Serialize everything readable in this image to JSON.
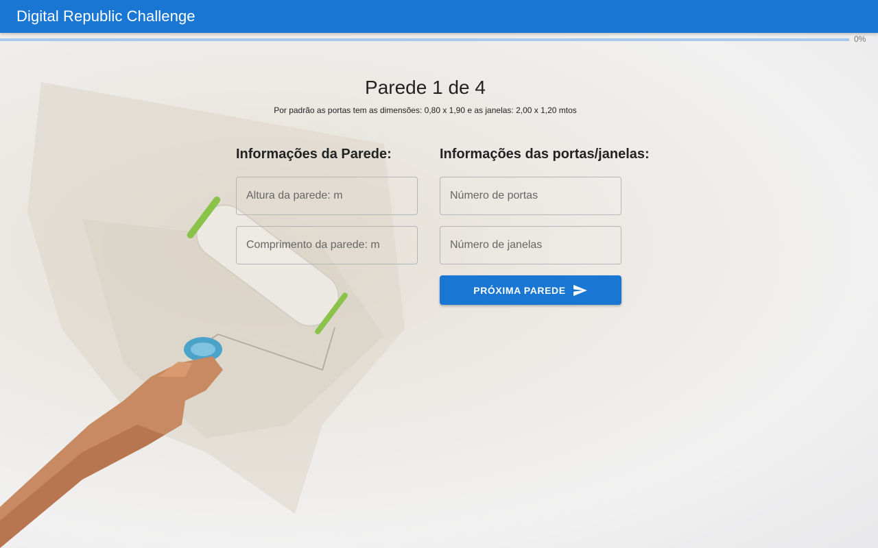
{
  "app": {
    "title": "Digital Republic Challenge"
  },
  "progress": {
    "value": 0,
    "label": "0%"
  },
  "wall": {
    "title": "Parede 1 de 4",
    "subtitle": "Por padrão as portas tem as dimensões: 0,80 x 1,90 e as janelas: 2,00 x 1,20 mtos"
  },
  "wall_info": {
    "title": "Informações da Parede:",
    "height_placeholder": "Altura da parede: m",
    "length_placeholder": "Comprimento da parede: m"
  },
  "openings_info": {
    "title": "Informações das portas/janelas:",
    "doors_placeholder": "Número de portas",
    "windows_placeholder": "Número de janelas"
  },
  "next_button": {
    "label": "PRÓXIMA PAREDE",
    "icon": "send-icon"
  },
  "colors": {
    "primary": "#1976d2",
    "progress_track": "#a9c9ec"
  }
}
